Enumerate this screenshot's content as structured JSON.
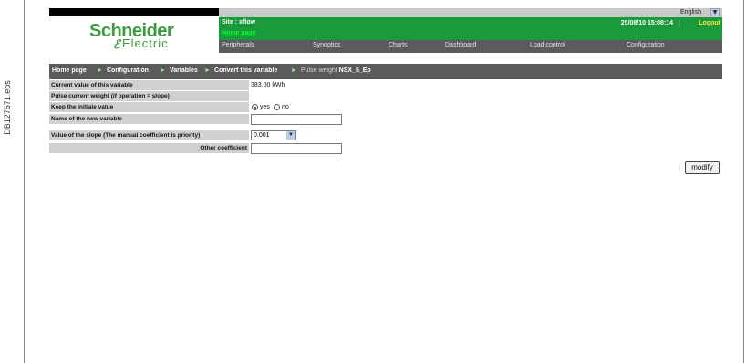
{
  "side_label": "DB127671.eps",
  "header": {
    "language": "English",
    "logo_main": "Schneider",
    "logo_sub": "Electric",
    "site": "Site : xflow",
    "home_link": "Home page",
    "datetime": "25/08/10 15:08:14",
    "separator": "|",
    "logout": "Logout"
  },
  "nav": {
    "items": [
      "Peripherals",
      "Synoptics",
      "Charts",
      "Dashboard",
      "Load control",
      "Configuration"
    ]
  },
  "breadcrumb": {
    "items": [
      "Home page",
      "Configuration",
      "Variables",
      "Convert this variable"
    ],
    "current_prefix": "Pulse weight",
    "current_name": "NSX_5_Ep"
  },
  "form": {
    "current_value_label": "Current value of this variable",
    "current_value": "383.00 kWh",
    "pulse_weight_label": "Pulse current weight (if operation = slope)",
    "keep_initial_label": "Keep the initiale value",
    "keep_yes": "yes",
    "keep_no": "no",
    "new_variable_label": "Name of the new variable",
    "new_variable_value": "",
    "slope_label": "Value of the slope (The manual coefficient is priority)",
    "slope_value": "0.001",
    "other_coefficient_label": "Other coefficient",
    "other_coefficient_value": ""
  },
  "actions": {
    "modify": "modify"
  }
}
